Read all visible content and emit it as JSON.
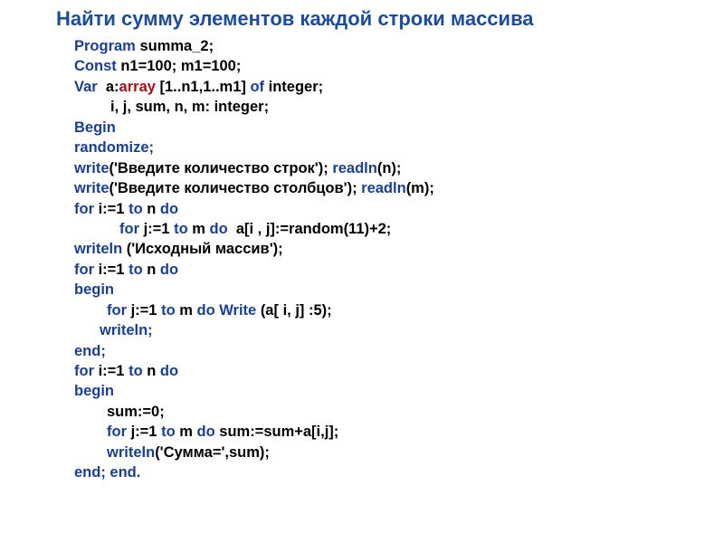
{
  "title": "Найти сумму элементов каждой строки массива",
  "code": {
    "l1_kw": "Program ",
    "l1_txt": "summa_2;",
    "l2_kw": "Const ",
    "l2_txt": "n1=100; m1=100;",
    "l3_kw1": "Var  ",
    "l3_txt1": "a:",
    "l3_kw2": "array ",
    "l3_txt2": "[1..n1,1..m1] ",
    "l3_kw3": "of ",
    "l3_txt3": "integer;",
    "l4_txt": "i, j, sum, n, m: integer;",
    "l5_kw": "Begin",
    "l6_kw": "randomize;",
    "l7_kw1": "write",
    "l7_txt1": "('Введите количество строк'); ",
    "l7_kw2": "readln",
    "l7_txt2": "(n);",
    "l8_kw1": "write",
    "l8_txt1": "('Введите количество столбцов'); ",
    "l8_kw2": "readln",
    "l8_txt2": "(m);",
    "l9_kw1": "for ",
    "l9_txt1": "i:=1 ",
    "l9_kw2": "to ",
    "l9_txt2": "n ",
    "l9_kw3": "do",
    "l10_kw1": "for ",
    "l10_txt1": "j:=1 ",
    "l10_kw2": "to ",
    "l10_txt2": "m ",
    "l10_kw3": "do  ",
    "l10_txt3": "a[i , j]:=random(11)+2;",
    "l11_kw": "writeln ",
    "l11_txt": "('Исходный массив');",
    "l12_kw1": "for ",
    "l12_txt1": "i:=1 ",
    "l12_kw2": "to ",
    "l12_txt2": "n ",
    "l12_kw3": "do",
    "l13_kw": "begin",
    "l14_kw1": "for ",
    "l14_txt1": "j:=1 ",
    "l14_kw2": "to ",
    "l14_txt2": "m ",
    "l14_kw3": "do ",
    "l14_kw4": "Write ",
    "l14_txt3": "(a[ i, j] :5);",
    "l15_kw": "writeln;",
    "l16_kw": "end;",
    "l17_kw1": "for ",
    "l17_txt1": "i:=1 ",
    "l17_kw2": "to ",
    "l17_txt2": "n ",
    "l17_kw3": "do",
    "l18_kw": "begin",
    "l19_txt": "sum:=0;",
    "l20_kw1": "for ",
    "l20_txt1": "j:=1 ",
    "l20_kw2": "to ",
    "l20_txt2": "m ",
    "l20_kw3": "do ",
    "l20_txt3": "sum:=sum+a[i,j];",
    "l21_kw": "writeln",
    "l21_txt": "('Сумма=',sum);",
    "l22_kw1": "end; ",
    "l22_kw2": "end."
  }
}
